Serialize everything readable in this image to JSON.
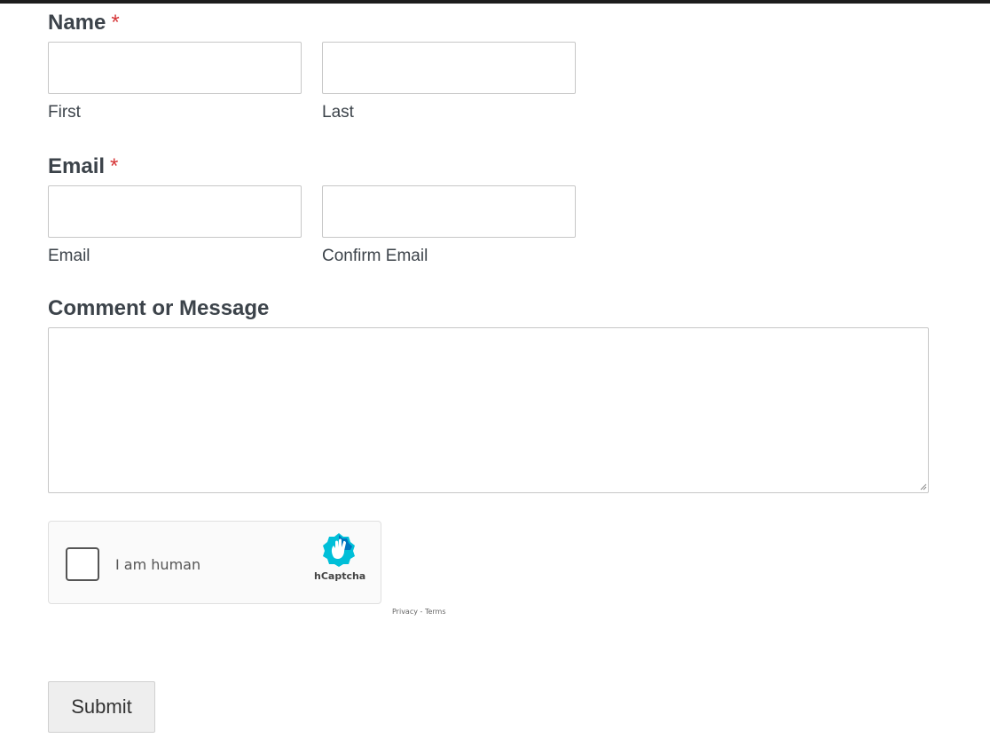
{
  "form": {
    "name_field": {
      "label": "Name",
      "required_marker": "*",
      "first": {
        "value": "",
        "sublabel": "First"
      },
      "last": {
        "value": "",
        "sublabel": "Last"
      }
    },
    "email_field": {
      "label": "Email",
      "required_marker": "*",
      "email": {
        "value": "",
        "sublabel": "Email"
      },
      "confirm": {
        "value": "",
        "sublabel": "Confirm Email"
      }
    },
    "message_field": {
      "label": "Comment or Message",
      "value": ""
    },
    "captcha": {
      "checkbox_label": "I am human",
      "brand": "hCaptcha",
      "brand_icon": "hcaptcha-hand-icon",
      "privacy_link": "Privacy",
      "separator": "-",
      "terms_link": "Terms",
      "checked": false
    },
    "submit_label": "Submit"
  },
  "colors": {
    "required": "#d63638",
    "text": "#3c434a",
    "border": "#c7c7c7",
    "button_bg": "#eeeeee",
    "captcha_brand": "#00bfd8"
  }
}
